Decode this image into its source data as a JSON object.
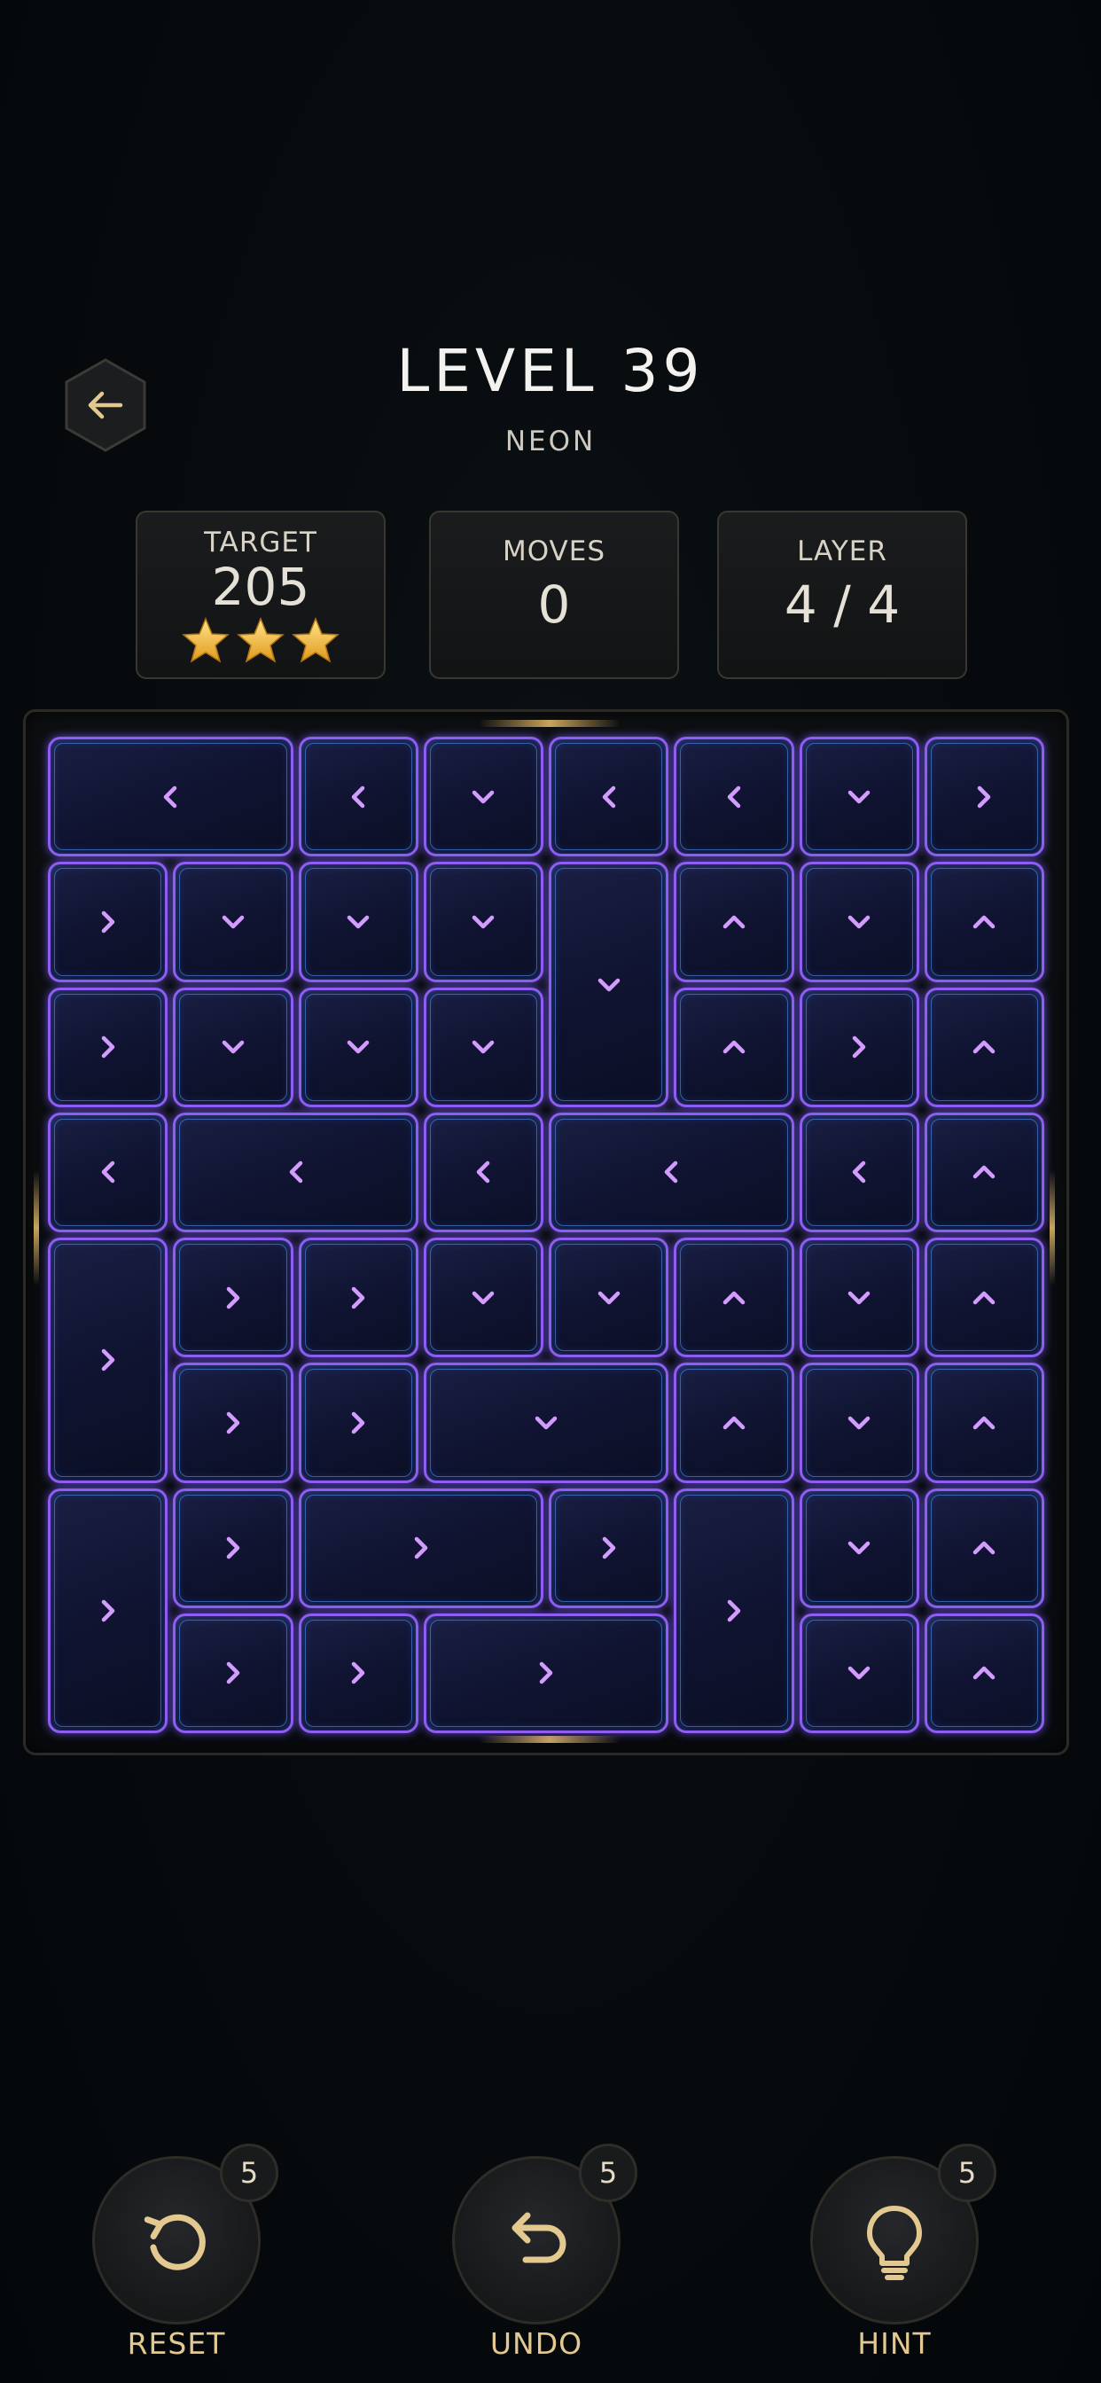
{
  "header": {
    "title": "LEVEL 39",
    "subtitle": "NEON"
  },
  "stats": {
    "target_label": "TARGET",
    "target_value": "205",
    "stars": 3,
    "moves_label": "MOVES",
    "moves_value": "0",
    "layer_label": "LAYER",
    "layer_value": "4 / 4"
  },
  "board": {
    "cols": 8,
    "rows": 8,
    "blocks": [
      {
        "c": 0,
        "r": 0,
        "w": 2,
        "h": 1,
        "dir": "left"
      },
      {
        "c": 2,
        "r": 0,
        "w": 1,
        "h": 1,
        "dir": "left"
      },
      {
        "c": 3,
        "r": 0,
        "w": 1,
        "h": 1,
        "dir": "down"
      },
      {
        "c": 4,
        "r": 0,
        "w": 1,
        "h": 1,
        "dir": "left"
      },
      {
        "c": 5,
        "r": 0,
        "w": 1,
        "h": 1,
        "dir": "left"
      },
      {
        "c": 6,
        "r": 0,
        "w": 1,
        "h": 1,
        "dir": "down"
      },
      {
        "c": 7,
        "r": 0,
        "w": 1,
        "h": 1,
        "dir": "right"
      },
      {
        "c": 0,
        "r": 1,
        "w": 1,
        "h": 1,
        "dir": "right"
      },
      {
        "c": 1,
        "r": 1,
        "w": 1,
        "h": 1,
        "dir": "down"
      },
      {
        "c": 2,
        "r": 1,
        "w": 1,
        "h": 1,
        "dir": "down"
      },
      {
        "c": 3,
        "r": 1,
        "w": 1,
        "h": 1,
        "dir": "down"
      },
      {
        "c": 4,
        "r": 1,
        "w": 1,
        "h": 2,
        "dir": "down"
      },
      {
        "c": 5,
        "r": 1,
        "w": 1,
        "h": 1,
        "dir": "up"
      },
      {
        "c": 6,
        "r": 1,
        "w": 1,
        "h": 1,
        "dir": "down"
      },
      {
        "c": 7,
        "r": 1,
        "w": 1,
        "h": 1,
        "dir": "up"
      },
      {
        "c": 0,
        "r": 2,
        "w": 1,
        "h": 1,
        "dir": "right"
      },
      {
        "c": 1,
        "r": 2,
        "w": 1,
        "h": 1,
        "dir": "down"
      },
      {
        "c": 2,
        "r": 2,
        "w": 1,
        "h": 1,
        "dir": "down"
      },
      {
        "c": 3,
        "r": 2,
        "w": 1,
        "h": 1,
        "dir": "down"
      },
      {
        "c": 5,
        "r": 2,
        "w": 1,
        "h": 1,
        "dir": "up"
      },
      {
        "c": 6,
        "r": 2,
        "w": 1,
        "h": 1,
        "dir": "right"
      },
      {
        "c": 7,
        "r": 2,
        "w": 1,
        "h": 1,
        "dir": "up"
      },
      {
        "c": 0,
        "r": 3,
        "w": 1,
        "h": 1,
        "dir": "left"
      },
      {
        "c": 1,
        "r": 3,
        "w": 2,
        "h": 1,
        "dir": "left"
      },
      {
        "c": 3,
        "r": 3,
        "w": 1,
        "h": 1,
        "dir": "left"
      },
      {
        "c": 4,
        "r": 3,
        "w": 2,
        "h": 1,
        "dir": "left"
      },
      {
        "c": 6,
        "r": 3,
        "w": 1,
        "h": 1,
        "dir": "left"
      },
      {
        "c": 7,
        "r": 3,
        "w": 1,
        "h": 1,
        "dir": "up"
      },
      {
        "c": 0,
        "r": 4,
        "w": 1,
        "h": 2,
        "dir": "right"
      },
      {
        "c": 1,
        "r": 4,
        "w": 1,
        "h": 1,
        "dir": "right"
      },
      {
        "c": 2,
        "r": 4,
        "w": 1,
        "h": 1,
        "dir": "right"
      },
      {
        "c": 3,
        "r": 4,
        "w": 1,
        "h": 1,
        "dir": "down"
      },
      {
        "c": 4,
        "r": 4,
        "w": 1,
        "h": 1,
        "dir": "down"
      },
      {
        "c": 5,
        "r": 4,
        "w": 1,
        "h": 1,
        "dir": "up"
      },
      {
        "c": 6,
        "r": 4,
        "w": 1,
        "h": 1,
        "dir": "down"
      },
      {
        "c": 7,
        "r": 4,
        "w": 1,
        "h": 1,
        "dir": "up"
      },
      {
        "c": 1,
        "r": 5,
        "w": 1,
        "h": 1,
        "dir": "right"
      },
      {
        "c": 2,
        "r": 5,
        "w": 1,
        "h": 1,
        "dir": "right"
      },
      {
        "c": 3,
        "r": 5,
        "w": 2,
        "h": 1,
        "dir": "down"
      },
      {
        "c": 5,
        "r": 5,
        "w": 1,
        "h": 1,
        "dir": "up"
      },
      {
        "c": 6,
        "r": 5,
        "w": 1,
        "h": 1,
        "dir": "down"
      },
      {
        "c": 7,
        "r": 5,
        "w": 1,
        "h": 1,
        "dir": "up"
      },
      {
        "c": 0,
        "r": 6,
        "w": 1,
        "h": 2,
        "dir": "right"
      },
      {
        "c": 1,
        "r": 6,
        "w": 1,
        "h": 1,
        "dir": "right"
      },
      {
        "c": 2,
        "r": 6,
        "w": 2,
        "h": 1,
        "dir": "right"
      },
      {
        "c": 4,
        "r": 6,
        "w": 1,
        "h": 1,
        "dir": "right"
      },
      {
        "c": 5,
        "r": 6,
        "w": 1,
        "h": 2,
        "dir": "right"
      },
      {
        "c": 6,
        "r": 6,
        "w": 1,
        "h": 1,
        "dir": "down"
      },
      {
        "c": 7,
        "r": 6,
        "w": 1,
        "h": 1,
        "dir": "up"
      },
      {
        "c": 1,
        "r": 7,
        "w": 1,
        "h": 1,
        "dir": "right"
      },
      {
        "c": 2,
        "r": 7,
        "w": 1,
        "h": 1,
        "dir": "right"
      },
      {
        "c": 3,
        "r": 7,
        "w": 2,
        "h": 1,
        "dir": "right"
      },
      {
        "c": 6,
        "r": 7,
        "w": 1,
        "h": 1,
        "dir": "down"
      },
      {
        "c": 7,
        "r": 7,
        "w": 1,
        "h": 1,
        "dir": "up"
      }
    ]
  },
  "controls": {
    "reset_label": "RESET",
    "reset_count": "5",
    "undo_label": "UNDO",
    "undo_count": "5",
    "hint_label": "HINT",
    "hint_count": "5"
  },
  "colors": {
    "accent_gold": "#e3c890",
    "neon_purple": "#8f5df0",
    "neon_blue": "#5696ff",
    "arrow": "#d59cff"
  },
  "icons": [
    "back-arrow-icon",
    "star-icon",
    "reset-icon",
    "undo-icon",
    "hint-bulb-icon",
    "arrow-left-icon",
    "arrow-right-icon",
    "arrow-up-icon",
    "arrow-down-icon"
  ]
}
